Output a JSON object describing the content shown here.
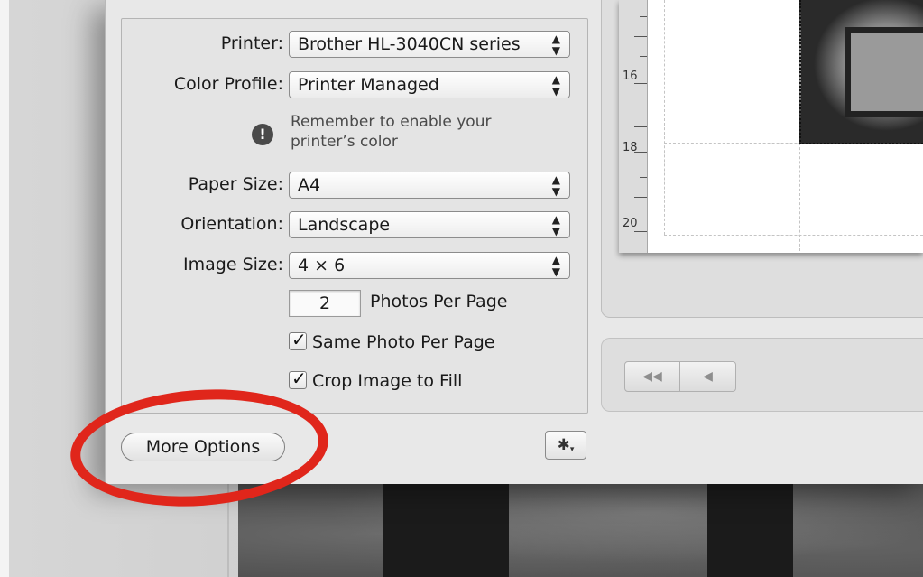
{
  "dialog": {
    "printer": {
      "label": "Printer:",
      "value": "Brother HL-3040CN series"
    },
    "color_profile": {
      "label": "Color Profile:",
      "value": "Printer Managed"
    },
    "warning": {
      "text": "Remember to enable your printer’s color"
    },
    "paper_size": {
      "label": "Paper Size:",
      "value": "A4"
    },
    "orientation": {
      "label": "Orientation:",
      "value": "Landscape"
    },
    "image_size": {
      "label": "Image Size:",
      "value": "4 × 6"
    },
    "photos_per_page": {
      "value": "2",
      "label": "Photos Per Page"
    },
    "same_photo": {
      "label": "Same Photo Per Page",
      "checked": true
    },
    "crop_image": {
      "label": "Crop Image to Fill",
      "checked": true
    },
    "more_options_label": "More Options"
  },
  "preview": {
    "ruler_numbers": [
      "16",
      "18",
      "20"
    ]
  },
  "glyphs": {
    "popup_up": "▲",
    "popup_down": "▼",
    "warn": "!",
    "check": "✓",
    "gear": "✱",
    "caret": "▾",
    "first": "◀◀",
    "prev": "◀"
  },
  "colors": {
    "highlight_ellipse": "#e0261b"
  }
}
